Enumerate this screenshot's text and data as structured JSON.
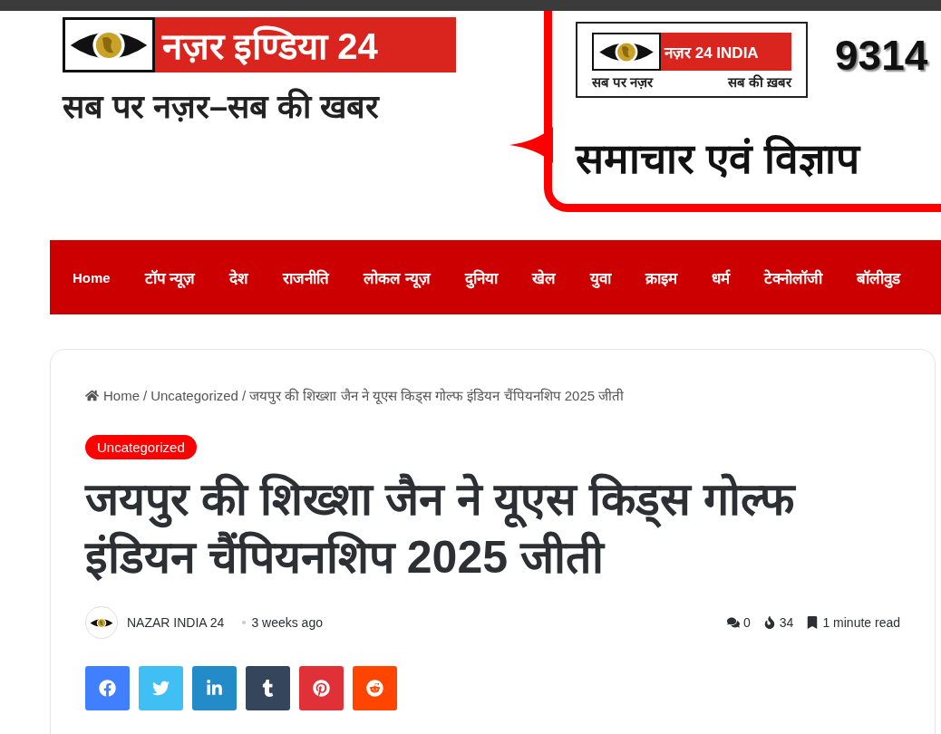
{
  "header": {
    "logo": {
      "name": "नज़र इण्डिया 24",
      "tagline": "सब पर नज़र–सब की खबर"
    },
    "ad": {
      "logo_name": "नज़र 24 INDIA",
      "tagline_left": "सब पर नज़र",
      "tagline_right": "सब की ख़बर",
      "phone": "9314",
      "headline": "समाचार एवं विज्ञाप"
    }
  },
  "nav": {
    "items": [
      {
        "label": "Home",
        "selected": true
      },
      {
        "label": "टॉप न्यूज़",
        "selected": false
      },
      {
        "label": "देश",
        "selected": false
      },
      {
        "label": "राजनीति",
        "selected": false
      },
      {
        "label": "लोकल न्यूज़",
        "selected": false
      },
      {
        "label": "दुनिया",
        "selected": false
      },
      {
        "label": "खेल",
        "selected": false
      },
      {
        "label": "युवा",
        "selected": false
      },
      {
        "label": "क्राइम",
        "selected": false
      },
      {
        "label": "धर्म",
        "selected": false
      },
      {
        "label": "टेक्नोलॉजी",
        "selected": false
      },
      {
        "label": "बॉलीवुड",
        "selected": false
      }
    ]
  },
  "article": {
    "breadcrumb_separator": "/",
    "breadcrumb": [
      "Home",
      "Uncategorized",
      "जयपुर की शिख्शा जैन ने यूएस किड्स गोल्फ इंडियन चैंपियनशिप 2025 जीती"
    ],
    "category": "Uncategorized",
    "title": "जयपुर की शिख्शा जैन ने यूएस किड्स गोल्फ इंडियन चैंपियनशिप 2025 जीती",
    "author": "NAZAR INDIA 24",
    "date": "3 weeks ago",
    "comments": "0",
    "views": "34",
    "read_time": "1 minute read",
    "share": [
      {
        "kind": "facebook"
      },
      {
        "kind": "twitter"
      },
      {
        "kind": "linkedin"
      },
      {
        "kind": "tumblr"
      },
      {
        "kind": "pinterest"
      },
      {
        "kind": "reddit"
      }
    ]
  }
}
